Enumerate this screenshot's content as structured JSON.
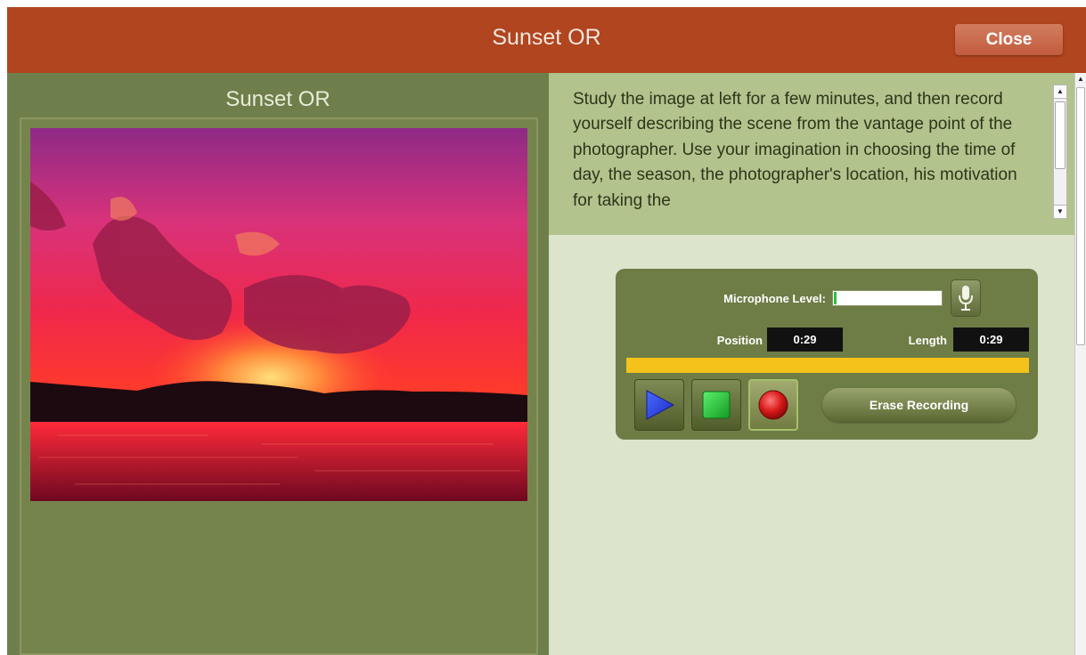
{
  "window": {
    "title": "Sunset OR",
    "close_label": "Close",
    "accent_color": "#b0451f"
  },
  "left_panel": {
    "title": "Sunset OR",
    "image_icon": "sunset-photo"
  },
  "instructions": {
    "text": "Study the image at left for a few minutes, and then record yourself describing the scene from the vantage point of the photographer.  Use your imagination in choosing the time of day, the season, the photographer's location, his motivation for taking the"
  },
  "recorder": {
    "mic_label": "Microphone Level:",
    "mic_level": 0.02,
    "mic_icon": "microphone-icon",
    "position_label": "Position",
    "position_value": "0:29",
    "length_label": "Length",
    "length_value": "0:29",
    "progress": 1.0,
    "progress_color": "#f4c21a",
    "play_icon": "play-icon",
    "stop_icon": "stop-icon",
    "record_icon": "record-icon",
    "erase_label": "Erase Recording"
  }
}
